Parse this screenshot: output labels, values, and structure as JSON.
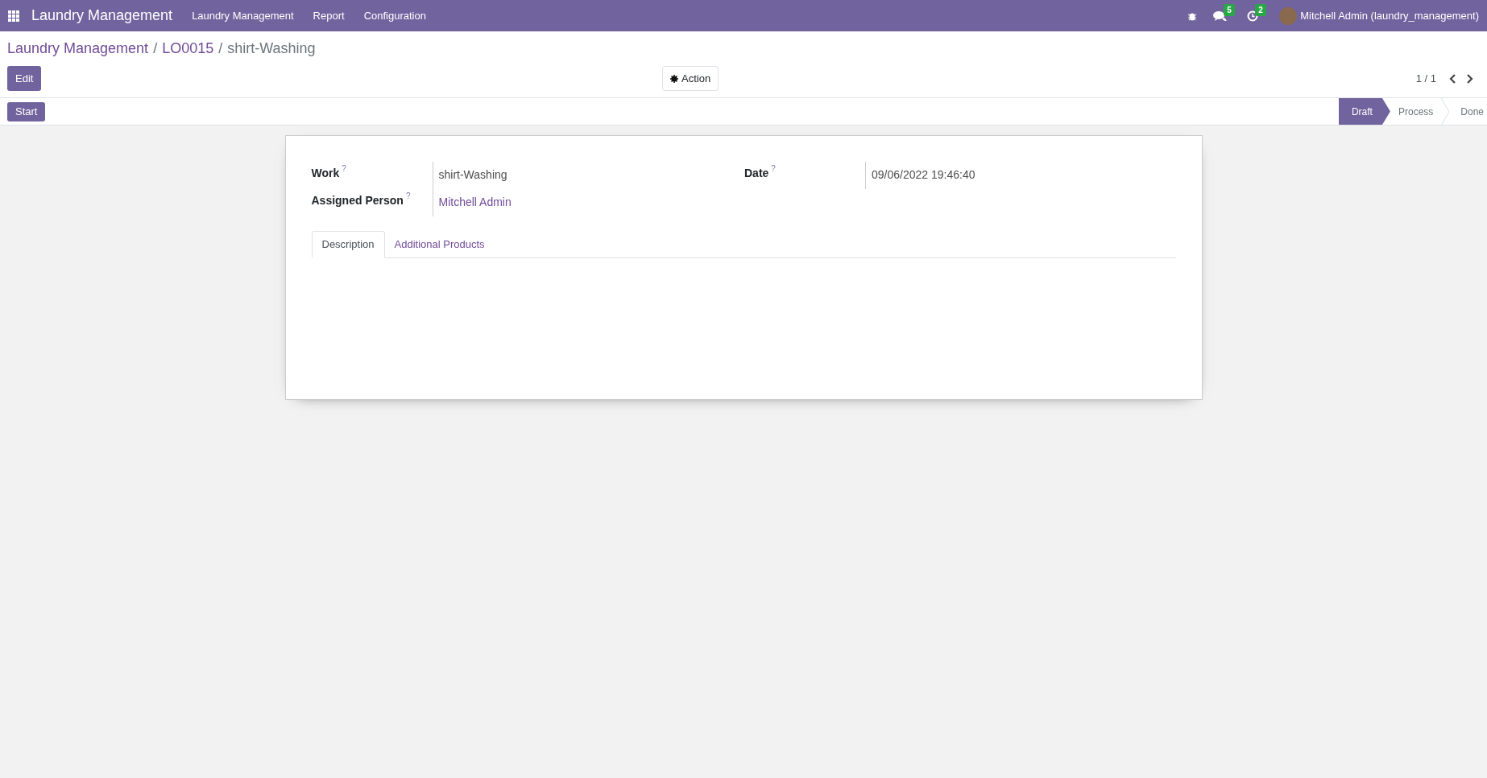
{
  "navbar": {
    "app_title": "Laundry Management",
    "menu": [
      "Laundry Management",
      "Report",
      "Configuration"
    ],
    "messages_badge": "5",
    "activities_badge": "2",
    "user": "Mitchell Admin (laundry_management)"
  },
  "breadcrumb": [
    {
      "label": "Laundry Management",
      "kind": "link"
    },
    {
      "separator": "/",
      "label": "LO0015",
      "kind": "link"
    },
    {
      "separator": "/",
      "label": "shirt-Washing",
      "kind": "current"
    }
  ],
  "control_panel": {
    "edit_button": "Edit",
    "action_button": "Action",
    "pager": "1 / 1"
  },
  "status_bar": {
    "buttons": [
      "Start"
    ],
    "stages": [
      {
        "label": "Draft",
        "selected": true
      },
      {
        "label": "Process",
        "selected": false
      },
      {
        "label": "Done",
        "selected": false
      }
    ]
  },
  "form": {
    "left_fields": [
      {
        "label": "Work",
        "help": "?",
        "value": "shirt-Washing",
        "kind": "text"
      },
      {
        "label": "Assigned Person",
        "help": "?",
        "value": "Mitchell Admin",
        "kind": "link"
      }
    ],
    "right_fields": [
      {
        "label": "Date",
        "help": "?",
        "value": "09/06/2022 19:46:40",
        "kind": "text"
      }
    ],
    "tabs": [
      {
        "label": "Description",
        "selected": true
      },
      {
        "label": "Additional Products",
        "selected": false
      }
    ]
  }
}
